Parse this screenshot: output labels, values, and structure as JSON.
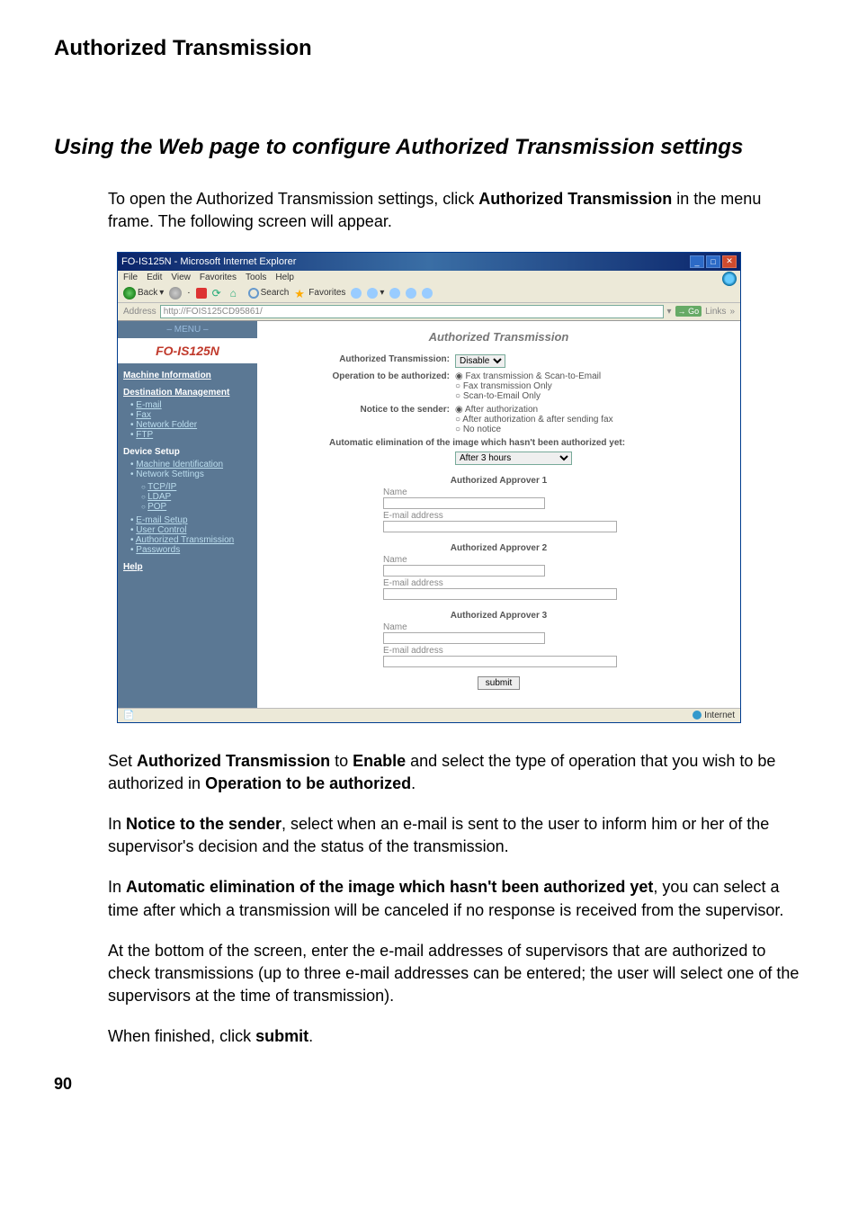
{
  "page": {
    "header": "Authorized Transmission",
    "section_title": "Using the Web page to configure Authorized Transmission settings",
    "intro_prefix": "To open the Authorized Transmission settings, click ",
    "intro_bold": "Authorized Transmission",
    "intro_suffix": " in the menu frame. The following screen will appear.",
    "page_number": "90"
  },
  "prose": {
    "p1_a": "Set ",
    "p1_b1": "Authorized Transmission",
    "p1_b": " to ",
    "p1_b2": "Enable",
    "p1_c": " and select the type of operation that you wish to be authorized in ",
    "p1_b3": "Operation to be authorized",
    "p1_d": ".",
    "p2_a": "In ",
    "p2_b1": "Notice to the sender",
    "p2_b": ", select when an e-mail is sent to the user to inform him or her of the supervisor's decision and the status of the transmission.",
    "p3_a": "In ",
    "p3_b1": "Automatic elimination of the image which hasn't been authorized yet",
    "p3_b": ", you can select a time after which a transmission will be canceled if no response is received from the supervisor.",
    "p4": "At the bottom of the screen, enter the e-mail addresses of supervisors that are authorized to check transmissions (up to three e-mail addresses can be entered; the user will select one of the supervisors at the time of transmission).",
    "p5_a": "When finished, click ",
    "p5_b1": "submit",
    "p5_b": "."
  },
  "browser": {
    "title": "FO-IS125N - Microsoft Internet Explorer",
    "menus": [
      "File",
      "Edit",
      "View",
      "Favorites",
      "Tools",
      "Help"
    ],
    "toolbar": {
      "back": "Back",
      "search": "Search",
      "favorites": "Favorites"
    },
    "address_label": "Address",
    "address_value": "http://FOIS125CD95861/",
    "go": "Go",
    "links": "Links",
    "status_zone": "Internet"
  },
  "sidebar": {
    "menu_label": "– MENU –",
    "brand": "FO-IS125N",
    "machine_info": "Machine Information",
    "dest_mgmt": "Destination Management",
    "dest_items": [
      "E-mail",
      "Fax",
      "Network Folder",
      "FTP"
    ],
    "device_setup": "Device Setup",
    "device_items": {
      "machine_ident": "Machine Identification",
      "network_settings": "Network Settings",
      "net_sub": [
        "TCP/IP",
        "LDAP",
        "POP"
      ],
      "email_setup": "E-mail Setup",
      "user_control": "User Control",
      "authorized_trans": "Authorized Transmission",
      "passwords": "Passwords"
    },
    "help": "Help"
  },
  "form": {
    "heading": "Authorized Transmission",
    "auth_trans_label": "Authorized Transmission:",
    "auth_trans_value": "Disable",
    "operation_label": "Operation to be authorized:",
    "operation_options": [
      "Fax transmission & Scan-to-Email",
      "Fax transmission Only",
      "Scan-to-Email Only"
    ],
    "notice_label": "Notice to the sender:",
    "notice_options": [
      "After authorization",
      "After authorization & after sending fax",
      "No notice"
    ],
    "auto_elim_label": "Automatic elimination of the image which hasn't been authorized yet:",
    "auto_elim_value": "After 3 hours",
    "approvers": [
      {
        "title": "Authorized Approver 1",
        "name_label": "Name",
        "email_label": "E-mail address"
      },
      {
        "title": "Authorized Approver 2",
        "name_label": "Name",
        "email_label": "E-mail address"
      },
      {
        "title": "Authorized Approver 3",
        "name_label": "Name",
        "email_label": "E-mail address"
      }
    ],
    "submit": "submit"
  }
}
